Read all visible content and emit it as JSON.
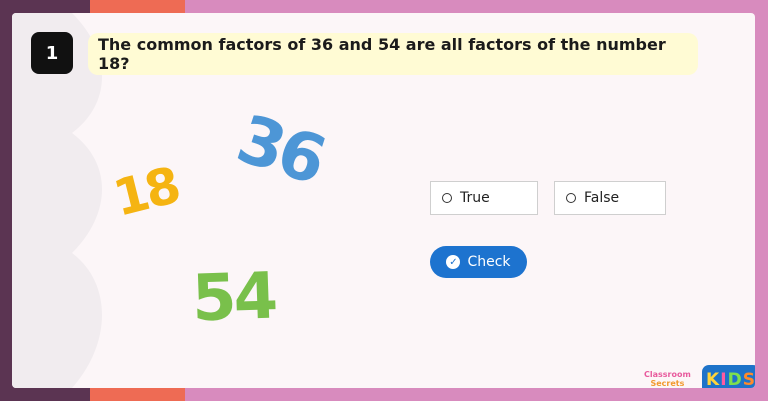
{
  "question": {
    "number": "1",
    "text": "The common factors of 36 and 54 are all factors of the number 18?"
  },
  "illustration": {
    "numbers": [
      "36",
      "18",
      "54"
    ]
  },
  "options": [
    {
      "label": "True"
    },
    {
      "label": "False"
    }
  ],
  "check_button": {
    "label": "Check"
  },
  "branding": {
    "classroom_line1": "Classroom",
    "classroom_line2": "Secrets",
    "kids": [
      "K",
      "I",
      "D",
      "S"
    ]
  }
}
